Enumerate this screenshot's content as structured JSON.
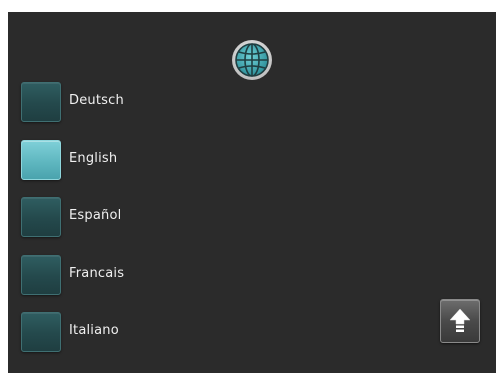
{
  "header": {
    "icon": "globe-icon"
  },
  "languages": [
    {
      "label": "Deutsch",
      "selected": false
    },
    {
      "label": "English",
      "selected": true
    },
    {
      "label": "Español",
      "selected": false
    },
    {
      "label": "Francais",
      "selected": false
    },
    {
      "label": "Italiano",
      "selected": false
    }
  ],
  "footer": {
    "up_icon": "arrow-up-icon"
  },
  "colors": {
    "background": "#2b2b2b",
    "accent": "#5fb7c0",
    "box_default": "#24494c"
  }
}
